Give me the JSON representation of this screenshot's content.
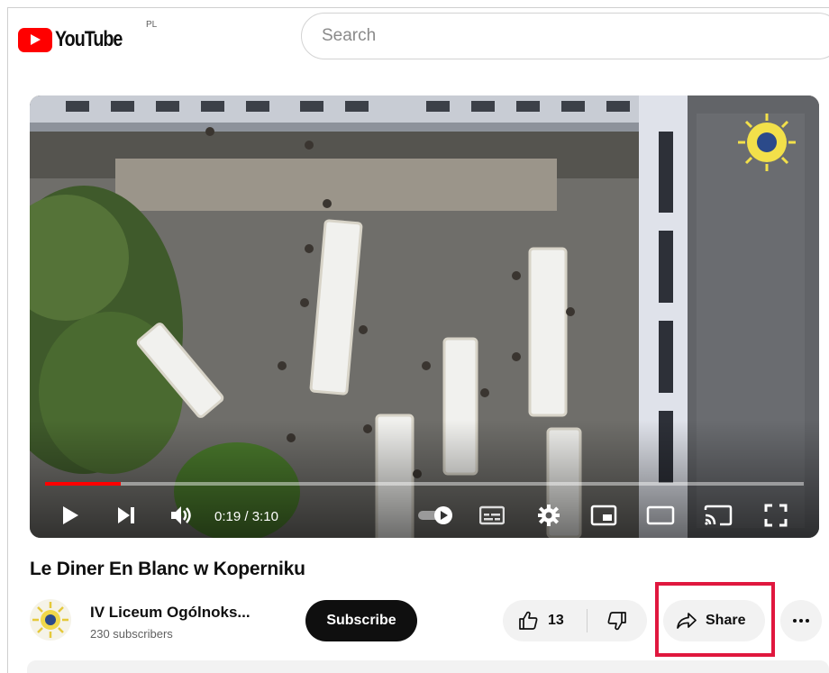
{
  "header": {
    "logo_text": "YouTube",
    "country_code": "PL",
    "search_placeholder": "Search"
  },
  "player": {
    "time_current": "0:19",
    "time_separator": " / ",
    "time_total": "3:10",
    "progress_fraction": 0.1,
    "controls": [
      "play-icon",
      "next-icon",
      "volume-icon",
      "autoplay-toggle",
      "subtitles-icon",
      "settings-icon",
      "miniplayer-icon",
      "theater-mode-icon",
      "cast-icon",
      "fullscreen-icon"
    ]
  },
  "video": {
    "title": "Le Diner En Blanc w Koperniku"
  },
  "channel": {
    "name": "IV Liceum Ogólnoks...",
    "subscribers": "230 subscribers"
  },
  "actions": {
    "subscribe_label": "Subscribe",
    "like_count": "13",
    "share_label": "Share",
    "more_icon": "more-horizontal-icon"
  },
  "colors": {
    "brand_red": "#ff0000",
    "highlight": "#e0173e",
    "button_bg": "#f2f2f2",
    "subscribe_bg": "#0f0f0f"
  }
}
